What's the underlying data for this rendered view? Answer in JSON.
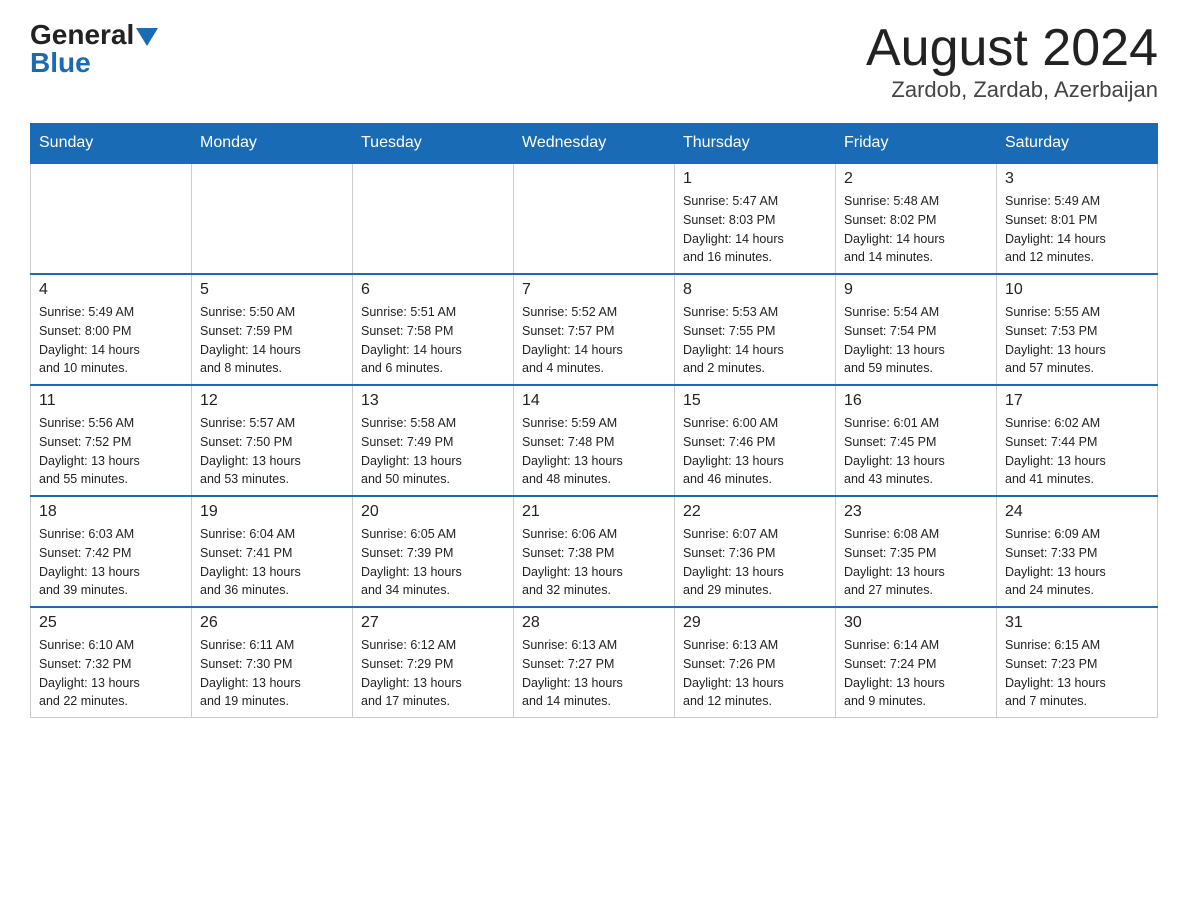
{
  "header": {
    "logo_general": "General",
    "logo_blue": "Blue",
    "title": "August 2024",
    "subtitle": "Zardob, Zardab, Azerbaijan"
  },
  "days_of_week": [
    "Sunday",
    "Monday",
    "Tuesday",
    "Wednesday",
    "Thursday",
    "Friday",
    "Saturday"
  ],
  "weeks": [
    [
      {
        "day": "",
        "info": ""
      },
      {
        "day": "",
        "info": ""
      },
      {
        "day": "",
        "info": ""
      },
      {
        "day": "",
        "info": ""
      },
      {
        "day": "1",
        "info": "Sunrise: 5:47 AM\nSunset: 8:03 PM\nDaylight: 14 hours\nand 16 minutes."
      },
      {
        "day": "2",
        "info": "Sunrise: 5:48 AM\nSunset: 8:02 PM\nDaylight: 14 hours\nand 14 minutes."
      },
      {
        "day": "3",
        "info": "Sunrise: 5:49 AM\nSunset: 8:01 PM\nDaylight: 14 hours\nand 12 minutes."
      }
    ],
    [
      {
        "day": "4",
        "info": "Sunrise: 5:49 AM\nSunset: 8:00 PM\nDaylight: 14 hours\nand 10 minutes."
      },
      {
        "day": "5",
        "info": "Sunrise: 5:50 AM\nSunset: 7:59 PM\nDaylight: 14 hours\nand 8 minutes."
      },
      {
        "day": "6",
        "info": "Sunrise: 5:51 AM\nSunset: 7:58 PM\nDaylight: 14 hours\nand 6 minutes."
      },
      {
        "day": "7",
        "info": "Sunrise: 5:52 AM\nSunset: 7:57 PM\nDaylight: 14 hours\nand 4 minutes."
      },
      {
        "day": "8",
        "info": "Sunrise: 5:53 AM\nSunset: 7:55 PM\nDaylight: 14 hours\nand 2 minutes."
      },
      {
        "day": "9",
        "info": "Sunrise: 5:54 AM\nSunset: 7:54 PM\nDaylight: 13 hours\nand 59 minutes."
      },
      {
        "day": "10",
        "info": "Sunrise: 5:55 AM\nSunset: 7:53 PM\nDaylight: 13 hours\nand 57 minutes."
      }
    ],
    [
      {
        "day": "11",
        "info": "Sunrise: 5:56 AM\nSunset: 7:52 PM\nDaylight: 13 hours\nand 55 minutes."
      },
      {
        "day": "12",
        "info": "Sunrise: 5:57 AM\nSunset: 7:50 PM\nDaylight: 13 hours\nand 53 minutes."
      },
      {
        "day": "13",
        "info": "Sunrise: 5:58 AM\nSunset: 7:49 PM\nDaylight: 13 hours\nand 50 minutes."
      },
      {
        "day": "14",
        "info": "Sunrise: 5:59 AM\nSunset: 7:48 PM\nDaylight: 13 hours\nand 48 minutes."
      },
      {
        "day": "15",
        "info": "Sunrise: 6:00 AM\nSunset: 7:46 PM\nDaylight: 13 hours\nand 46 minutes."
      },
      {
        "day": "16",
        "info": "Sunrise: 6:01 AM\nSunset: 7:45 PM\nDaylight: 13 hours\nand 43 minutes."
      },
      {
        "day": "17",
        "info": "Sunrise: 6:02 AM\nSunset: 7:44 PM\nDaylight: 13 hours\nand 41 minutes."
      }
    ],
    [
      {
        "day": "18",
        "info": "Sunrise: 6:03 AM\nSunset: 7:42 PM\nDaylight: 13 hours\nand 39 minutes."
      },
      {
        "day": "19",
        "info": "Sunrise: 6:04 AM\nSunset: 7:41 PM\nDaylight: 13 hours\nand 36 minutes."
      },
      {
        "day": "20",
        "info": "Sunrise: 6:05 AM\nSunset: 7:39 PM\nDaylight: 13 hours\nand 34 minutes."
      },
      {
        "day": "21",
        "info": "Sunrise: 6:06 AM\nSunset: 7:38 PM\nDaylight: 13 hours\nand 32 minutes."
      },
      {
        "day": "22",
        "info": "Sunrise: 6:07 AM\nSunset: 7:36 PM\nDaylight: 13 hours\nand 29 minutes."
      },
      {
        "day": "23",
        "info": "Sunrise: 6:08 AM\nSunset: 7:35 PM\nDaylight: 13 hours\nand 27 minutes."
      },
      {
        "day": "24",
        "info": "Sunrise: 6:09 AM\nSunset: 7:33 PM\nDaylight: 13 hours\nand 24 minutes."
      }
    ],
    [
      {
        "day": "25",
        "info": "Sunrise: 6:10 AM\nSunset: 7:32 PM\nDaylight: 13 hours\nand 22 minutes."
      },
      {
        "day": "26",
        "info": "Sunrise: 6:11 AM\nSunset: 7:30 PM\nDaylight: 13 hours\nand 19 minutes."
      },
      {
        "day": "27",
        "info": "Sunrise: 6:12 AM\nSunset: 7:29 PM\nDaylight: 13 hours\nand 17 minutes."
      },
      {
        "day": "28",
        "info": "Sunrise: 6:13 AM\nSunset: 7:27 PM\nDaylight: 13 hours\nand 14 minutes."
      },
      {
        "day": "29",
        "info": "Sunrise: 6:13 AM\nSunset: 7:26 PM\nDaylight: 13 hours\nand 12 minutes."
      },
      {
        "day": "30",
        "info": "Sunrise: 6:14 AM\nSunset: 7:24 PM\nDaylight: 13 hours\nand 9 minutes."
      },
      {
        "day": "31",
        "info": "Sunrise: 6:15 AM\nSunset: 7:23 PM\nDaylight: 13 hours\nand 7 minutes."
      }
    ]
  ]
}
